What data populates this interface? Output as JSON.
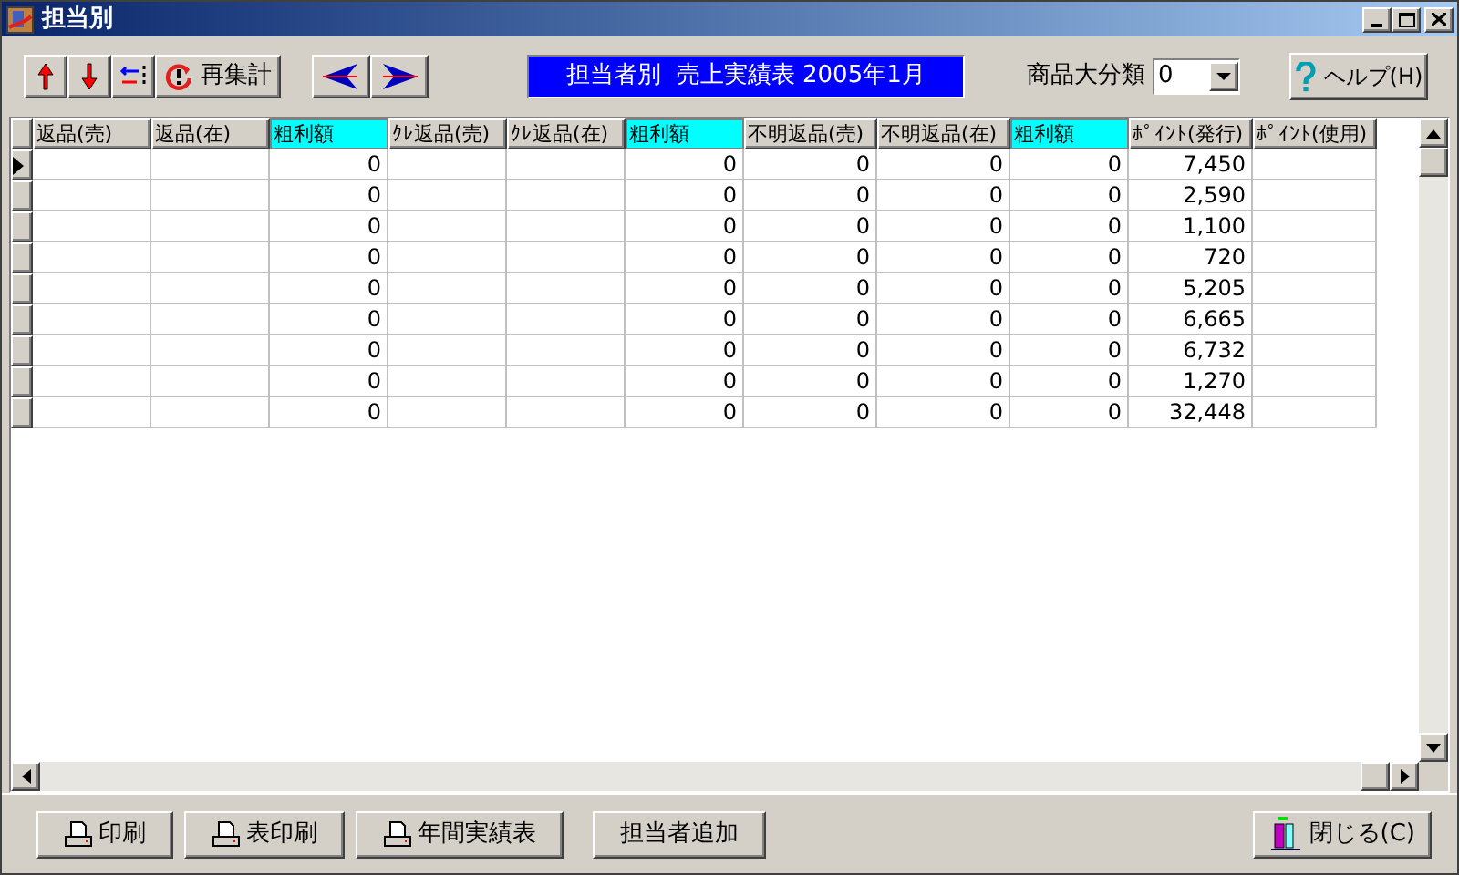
{
  "window": {
    "title": "担当別"
  },
  "toolbar": {
    "recalc_label": "再集計",
    "report_title": "担当者別  売上実績表 2005年1月",
    "category_label": "商品大分類",
    "category_value": "0",
    "help_label": "ヘルプ(H)"
  },
  "table": {
    "columns": [
      {
        "label": "返品(売)",
        "highlight": false
      },
      {
        "label": "返品(在)",
        "highlight": false
      },
      {
        "label": "粗利額",
        "highlight": true
      },
      {
        "label": "ｸﾚ返品(売)",
        "highlight": false
      },
      {
        "label": "ｸﾚ返品(在)",
        "highlight": false
      },
      {
        "label": "粗利額",
        "highlight": true
      },
      {
        "label": "不明返品(売)",
        "highlight": false
      },
      {
        "label": "不明返品(在)",
        "highlight": false
      },
      {
        "label": "粗利額",
        "highlight": true
      },
      {
        "label": "ﾎﾟｲﾝﾄ(発行)",
        "highlight": false
      },
      {
        "label": "ﾎﾟｲﾝﾄ(使用)",
        "highlight": false
      }
    ],
    "rows": [
      {
        "selected": true,
        "cells": [
          "",
          "",
          "0",
          "",
          "",
          "0",
          "0",
          "0",
          "0",
          "7,450",
          ""
        ]
      },
      {
        "selected": false,
        "cells": [
          "",
          "",
          "0",
          "",
          "",
          "0",
          "0",
          "0",
          "0",
          "2,590",
          ""
        ]
      },
      {
        "selected": false,
        "cells": [
          "",
          "",
          "0",
          "",
          "",
          "0",
          "0",
          "0",
          "0",
          "1,100",
          ""
        ]
      },
      {
        "selected": false,
        "cells": [
          "",
          "",
          "0",
          "",
          "",
          "0",
          "0",
          "0",
          "0",
          "720",
          ""
        ]
      },
      {
        "selected": false,
        "cells": [
          "",
          "",
          "0",
          "",
          "",
          "0",
          "0",
          "0",
          "0",
          "5,205",
          ""
        ]
      },
      {
        "selected": false,
        "cells": [
          "",
          "",
          "0",
          "",
          "",
          "0",
          "0",
          "0",
          "0",
          "6,665",
          ""
        ]
      },
      {
        "selected": false,
        "cells": [
          "",
          "",
          "0",
          "",
          "",
          "0",
          "0",
          "0",
          "0",
          "6,732",
          ""
        ]
      },
      {
        "selected": false,
        "cells": [
          "",
          "",
          "0",
          "",
          "",
          "0",
          "0",
          "0",
          "0",
          "1,270",
          ""
        ]
      },
      {
        "selected": false,
        "cells": [
          "",
          "",
          "0",
          "",
          "",
          "0",
          "0",
          "0",
          "0",
          "32,448",
          ""
        ]
      }
    ]
  },
  "footer": {
    "buttons": [
      {
        "label": "印刷",
        "kind": "print"
      },
      {
        "label": "表印刷",
        "kind": "print"
      },
      {
        "label": "年間実績表",
        "kind": "print"
      },
      {
        "label": "担当者追加",
        "kind": "plain"
      }
    ],
    "close_label": "閉じる(C)"
  }
}
